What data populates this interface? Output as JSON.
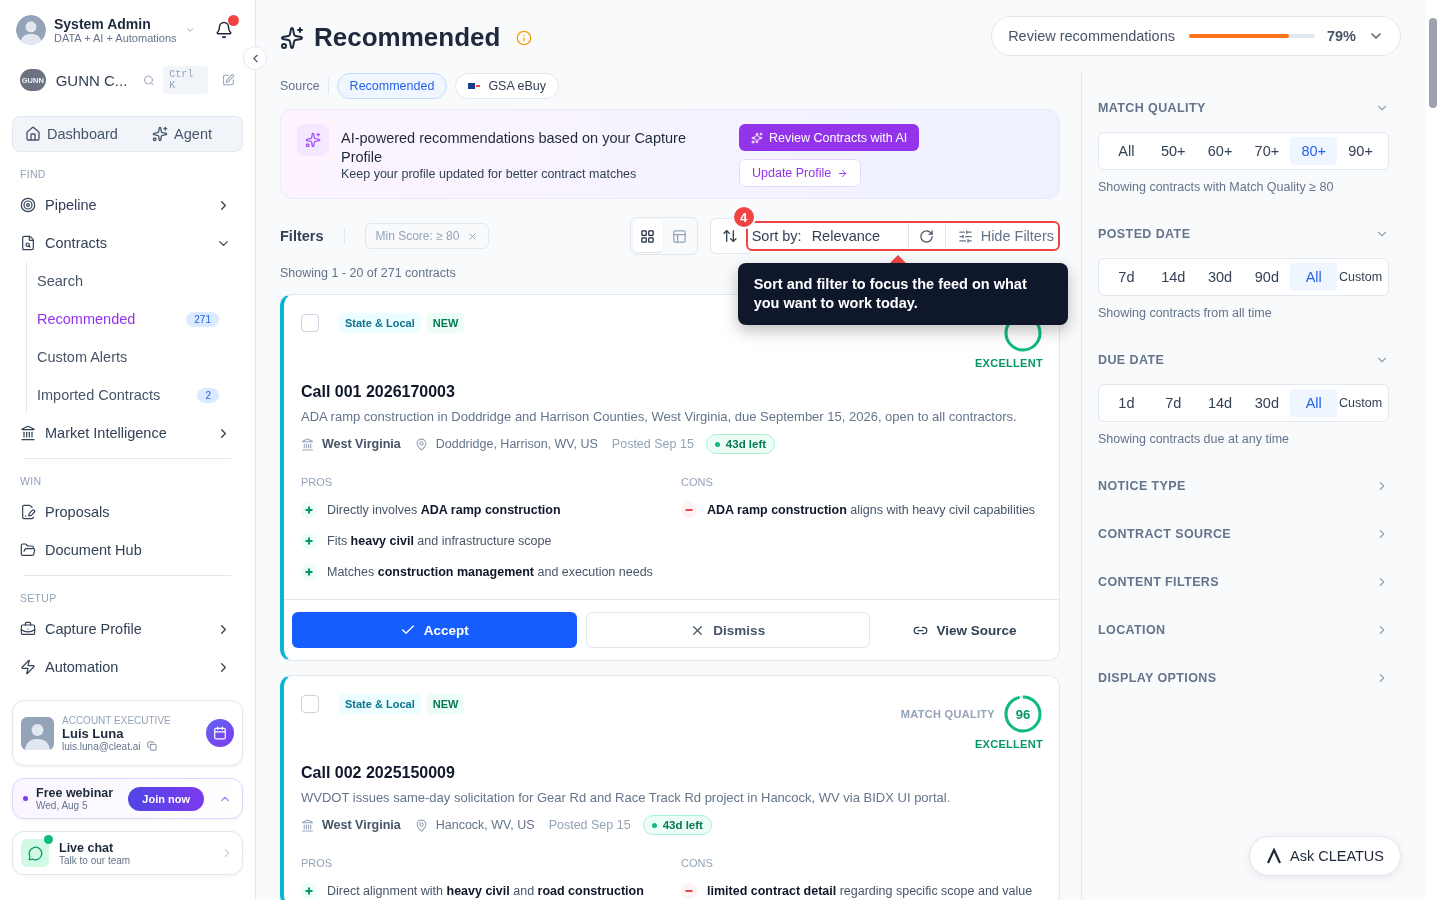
{
  "sidebar": {
    "user": {
      "name": "System Admin",
      "subtitle": "DATA + AI + Automations",
      "has_notifications": true
    },
    "workspace": {
      "logo_text": "GUNN",
      "name": "GUNN C...",
      "shortcut": "Ctrl K"
    },
    "quick_links": [
      {
        "label": "Dashboard"
      },
      {
        "label": "Agent"
      }
    ],
    "sections": [
      {
        "title": "FIND",
        "items": [
          {
            "label": "Pipeline",
            "kind": "group",
            "expanded": false
          },
          {
            "label": "Contracts",
            "kind": "group",
            "expanded": true,
            "children": [
              {
                "label": "Search",
                "selected": false
              },
              {
                "label": "Recommended",
                "selected": true,
                "count": "271"
              },
              {
                "label": "Custom Alerts",
                "selected": false
              },
              {
                "label": "Imported Contracts",
                "selected": false,
                "count": "2"
              }
            ]
          },
          {
            "label": "Market Intelligence",
            "kind": "group",
            "expanded": false
          }
        ]
      },
      {
        "title": "WIN",
        "items": [
          {
            "label": "Proposals",
            "kind": "link"
          },
          {
            "label": "Document Hub",
            "kind": "link"
          }
        ]
      },
      {
        "title": "SETUP",
        "items": [
          {
            "label": "Capture Profile",
            "kind": "group",
            "expanded": false
          },
          {
            "label": "Automation",
            "kind": "group",
            "expanded": false
          }
        ]
      }
    ],
    "account_executive": {
      "role": "ACCOUNT EXECUTIVE",
      "name": "Luis Luna",
      "email": "luis.luna@cleat.ai"
    },
    "webinar": {
      "title": "Free webinar",
      "date": "Wed, Aug 5",
      "button": "Join now"
    },
    "live_chat": {
      "title": "Live chat",
      "subtitle": "Talk to our team",
      "online": true
    }
  },
  "header": {
    "title": "Recommended",
    "review": {
      "label": "Review recommendations",
      "level": 0.79,
      "percent": "79%"
    }
  },
  "source": {
    "label": "Source",
    "chips": [
      {
        "label": "Recommended",
        "selected": true
      },
      {
        "label": "GSA eBuy",
        "selected": false
      }
    ]
  },
  "banner": {
    "title": "AI-powered recommendations based on your Capture Profile",
    "subtitle": "Keep your profile updated for better contract matches",
    "primary_button": "Review Contracts with AI",
    "secondary_button": "Update Profile"
  },
  "filters": {
    "label": "Filters",
    "chips": [
      "Min Score: ≥ 80"
    ],
    "views": [
      {
        "kind": "grid",
        "selected": true
      },
      {
        "kind": "table",
        "selected": false
      }
    ],
    "sort_label": "Sort by:",
    "sort_value": "Relevance",
    "hide_button": "Hide Filters"
  },
  "showing": "Showing 1 - 20 of 271 contracts",
  "tour": {
    "step": "4",
    "text": "Sort and filter to focus the feed on what you want to work today."
  },
  "contracts": [
    {
      "checked": false,
      "tags": [
        {
          "label": "State & Local",
          "kind": "category"
        },
        {
          "label": "NEW",
          "kind": "new"
        }
      ],
      "rating": "EXCELLENT",
      "title": "Call 001 2026170003",
      "description": "ADA ramp construction in Doddridge and Harrison Counties, West Virginia, due September 15, 2026, open to all contractors.",
      "agency": "West Virginia",
      "location": "Doddridge, Harrison, WV, US",
      "posted": "Posted Sep 15",
      "days_left": "43d left",
      "pros_label": "PROS",
      "cons_label": "CONS",
      "pros": [
        "Directly involves **ADA ramp construction**",
        "Fits **heavy civil** and infrastructure scope",
        "Matches **construction management** and execution needs"
      ],
      "cons": [
        "**ADA ramp construction** aligns with heavy civil capabilities"
      ],
      "actions": {
        "accept": "Accept",
        "dismiss": "Dismiss",
        "view": "View Source"
      }
    },
    {
      "checked": false,
      "tags": [
        {
          "label": "State & Local",
          "kind": "category"
        },
        {
          "label": "NEW",
          "kind": "new"
        }
      ],
      "match_label": "MATCH QUALITY",
      "score": "96",
      "rating": "EXCELLENT",
      "title": "Call 002 2025150009",
      "description": "WVDOT issues same-day solicitation for Gear Rd and Race Track Rd project in Hancock, WV via BIDX UI portal.",
      "agency": "West Virginia",
      "location": "Hancock, WV, US",
      "posted": "Posted Sep 15",
      "days_left": "43d left",
      "pros_label": "PROS",
      "cons_label": "CONS",
      "pros": [
        "Direct alignment with **heavy civil** and **road construction**"
      ],
      "cons": [
        "**limited contract detail** regarding specific scope and value"
      ]
    }
  ],
  "filter_panel": [
    {
      "title": "MATCH QUALITY",
      "expanded": true,
      "options": [
        {
          "label": "All",
          "selected": false
        },
        {
          "label": "50+",
          "selected": false
        },
        {
          "label": "60+",
          "selected": false
        },
        {
          "label": "70+",
          "selected": false
        },
        {
          "label": "80+",
          "selected": true
        },
        {
          "label": "90+",
          "selected": false
        }
      ],
      "note": "Showing contracts with Match Quality ≥ 80"
    },
    {
      "title": "POSTED DATE",
      "expanded": true,
      "options": [
        {
          "label": "7d",
          "selected": false
        },
        {
          "label": "14d",
          "selected": false
        },
        {
          "label": "30d",
          "selected": false
        },
        {
          "label": "90d",
          "selected": false
        },
        {
          "label": "All",
          "selected": true
        },
        {
          "label": "Custom",
          "selected": false,
          "kind": "small"
        }
      ],
      "note": "Showing contracts from all time"
    },
    {
      "title": "DUE DATE",
      "expanded": true,
      "options": [
        {
          "label": "1d",
          "selected": false
        },
        {
          "label": "7d",
          "selected": false
        },
        {
          "label": "14d",
          "selected": false
        },
        {
          "label": "30d",
          "selected": false
        },
        {
          "label": "All",
          "selected": true
        },
        {
          "label": "Custom",
          "selected": false,
          "kind": "small"
        }
      ],
      "note": "Showing contracts due at any time"
    },
    {
      "title": "NOTICE TYPE",
      "expanded": false
    },
    {
      "title": "CONTRACT SOURCE",
      "expanded": false
    },
    {
      "title": "CONTENT FILTERS",
      "expanded": false
    },
    {
      "title": "LOCATION",
      "expanded": false
    },
    {
      "title": "DISPLAY OPTIONS",
      "expanded": false
    }
  ],
  "ask_button": "Ask CLEATUS"
}
